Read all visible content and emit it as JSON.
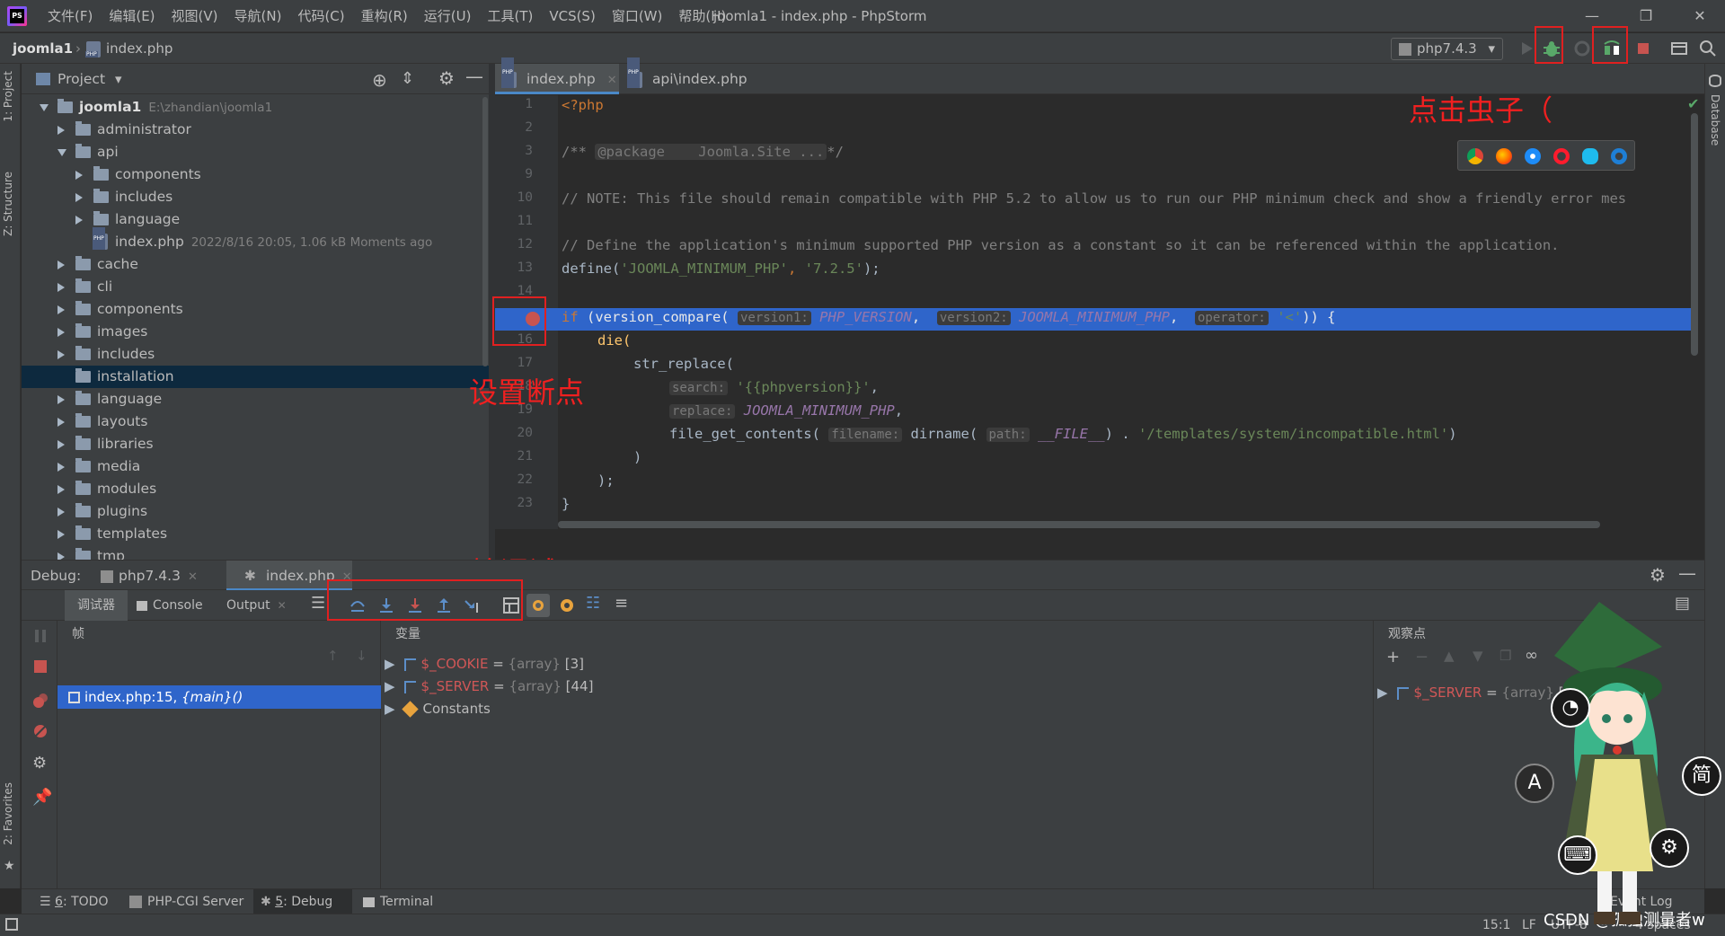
{
  "titlebar": {
    "menu": [
      "文件(F)",
      "编辑(E)",
      "视图(V)",
      "导航(N)",
      "代码(C)",
      "重构(R)",
      "运行(U)",
      "工具(T)",
      "VCS(S)",
      "窗口(W)",
      "帮助(H)"
    ],
    "window_title": "joomla1 - index.php - PhpStorm"
  },
  "navbar": {
    "project": "joomla1",
    "file": "index.php",
    "run_config": "php7.4.3"
  },
  "project_panel": {
    "title": "Project",
    "tree": [
      {
        "label": "joomla1",
        "meta": "E:\\zhandian\\joomla1",
        "depth": 0,
        "expanded": true,
        "type": "folder"
      },
      {
        "label": "administrator",
        "depth": 1,
        "expanded": false,
        "type": "folder"
      },
      {
        "label": "api",
        "depth": 1,
        "expanded": true,
        "type": "folder"
      },
      {
        "label": "components",
        "depth": 2,
        "expanded": false,
        "type": "folder"
      },
      {
        "label": "includes",
        "depth": 2,
        "expanded": false,
        "type": "folder"
      },
      {
        "label": "language",
        "depth": 2,
        "expanded": false,
        "type": "folder"
      },
      {
        "label": "index.php",
        "meta": "2022/8/16 20:05, 1.06 kB Moments ago",
        "depth": 2,
        "type": "file"
      },
      {
        "label": "cache",
        "depth": 1,
        "expanded": false,
        "type": "folder"
      },
      {
        "label": "cli",
        "depth": 1,
        "expanded": false,
        "type": "folder"
      },
      {
        "label": "components",
        "depth": 1,
        "expanded": false,
        "type": "folder"
      },
      {
        "label": "images",
        "depth": 1,
        "expanded": false,
        "type": "folder"
      },
      {
        "label": "includes",
        "depth": 1,
        "expanded": false,
        "type": "folder"
      },
      {
        "label": "installation",
        "depth": 1,
        "type": "folder",
        "selected": true
      },
      {
        "label": "language",
        "depth": 1,
        "expanded": false,
        "type": "folder"
      },
      {
        "label": "layouts",
        "depth": 1,
        "expanded": false,
        "type": "folder"
      },
      {
        "label": "libraries",
        "depth": 1,
        "expanded": false,
        "type": "folder"
      },
      {
        "label": "media",
        "depth": 1,
        "expanded": false,
        "type": "folder"
      },
      {
        "label": "modules",
        "depth": 1,
        "expanded": false,
        "type": "folder"
      },
      {
        "label": "plugins",
        "depth": 1,
        "expanded": false,
        "type": "folder"
      },
      {
        "label": "templates",
        "depth": 1,
        "expanded": false,
        "type": "folder"
      },
      {
        "label": "tmp",
        "depth": 1,
        "expanded": false,
        "type": "folder"
      }
    ]
  },
  "editor": {
    "tabs": [
      {
        "label": "index.php",
        "active": true
      },
      {
        "label": "api\\index.php",
        "active": false
      }
    ],
    "line_numbers": [
      "1",
      "2",
      "3",
      "9",
      "10",
      "11",
      "12",
      "13",
      "14",
      "15",
      "16",
      "17",
      "18",
      "19",
      "20",
      "21",
      "22",
      "23"
    ],
    "code": {
      "l1": "<?php",
      "l3_a": "/** ",
      "l3_b": "@package    Joomla.Site ...",
      "l3_c": "*/",
      "l10": "// NOTE: This file should remain compatible with PHP 5.2 to allow us to run our PHP minimum check and show a friendly error mes",
      "l12": "// Define the application's minimum supported PHP version as a constant so it can be referenced within the application.",
      "l13_fn": "define(",
      "l13_s1": "'JOOMLA_MINIMUM_PHP'",
      "l13_sep": ", ",
      "l13_s2": "'7.2.5'",
      "l13_end": ");",
      "l15_kw": "if",
      "l15_a": " (version_compare( ",
      "l15_h1": "version1:",
      "l15_c1": " PHP_VERSION",
      "l15_sep": ",  ",
      "l15_h2": "version2:",
      "l15_c2": " JOOMLA_MINIMUM_PHP",
      "l15_h3": "operator:",
      "l15_s": " '<'",
      "l15_end": ")) {",
      "l16": "die(",
      "l17": "str_replace(",
      "l18_h": "search:",
      "l18_s": " '{{phpversion}}'",
      "l18_end": ",",
      "l19_h": "replace:",
      "l19_c": " JOOMLA_MINIMUM_PHP",
      "l19_end": ",",
      "l20_a": "file_get_contents( ",
      "l20_h1": "filename:",
      "l20_b": " dirname( ",
      "l20_h2": "path:",
      "l20_c": " __FILE__",
      "l20_d": ") . ",
      "l20_s": "'/templates/system/incompatible.html'",
      "l20_e": ")",
      "l21": ")",
      "l22": ");",
      "l23": "}"
    }
  },
  "annotations": {
    "click_bug": "点击虫子（",
    "set_breakpoint": "设置断点",
    "start_debug": "开始调试"
  },
  "debug": {
    "label": "Debug:",
    "tabs": [
      {
        "label": "php7.4.3"
      },
      {
        "label": "index.php",
        "active": true
      }
    ],
    "toolbar_tabs": [
      "调试器",
      "Console",
      "Output"
    ],
    "frames_title": "帧",
    "frame_item": "index.php:15, ",
    "frame_item_main": "{main}()",
    "vars_title": "变量",
    "variables": [
      {
        "name": "$_COOKIE",
        "eq": " = ",
        "type": "{array}",
        "count": " [3]"
      },
      {
        "name": "$_SERVER",
        "eq": " = ",
        "type": "{array}",
        "count": " [44]"
      },
      {
        "name": "Constants"
      }
    ],
    "watches_title": "观察点",
    "watch_item": {
      "name": "$_SERVER",
      "eq": " = ",
      "type": "{array}",
      "count": " [4"
    }
  },
  "bottom_tabs": [
    {
      "num": "6",
      "label": ": TODO"
    },
    {
      "num": "",
      "label": "PHP-CGI Server"
    },
    {
      "num": "5",
      "label": ": Debug",
      "active": true
    },
    {
      "num": "",
      "label": "Terminal"
    }
  ],
  "event_log": "Event Log",
  "status_bar": {
    "position": "15:1",
    "line_sep": "LF",
    "encoding": "UTF-8",
    "indent": "4 spaces",
    "watermark": "CSDN @孤独测量者w"
  },
  "side_tabs": {
    "project": "1: Project",
    "structure": "Z: Structure",
    "favorites": "2: Favorites",
    "database": "Database"
  },
  "mascot": {
    "btn_simplified": "简",
    "btn_a": "A"
  },
  "colors": {
    "accent": "#2f65ca",
    "annotation": "#f02020",
    "keyword": "#cc7832",
    "string": "#6a8759",
    "constant": "#9876aa"
  }
}
